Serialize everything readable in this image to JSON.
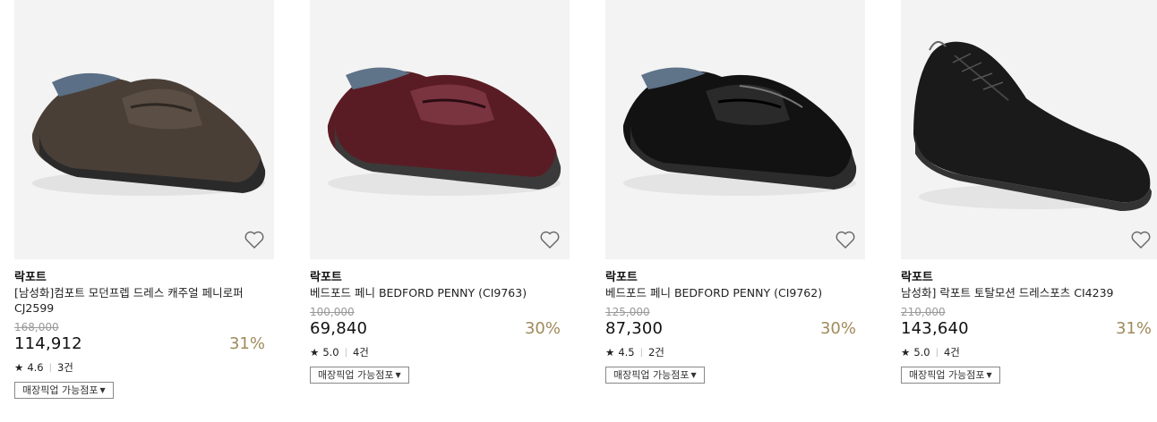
{
  "products": [
    {
      "brand": "락포트",
      "title": "[남성화]컴포트 모던프렙 드레스 캐주얼 페니로퍼 CJ2599",
      "original_price": "168,000",
      "sale_price": "114,912",
      "discount": "31%",
      "rating": "4.6",
      "review_count": "3건",
      "pickup_label": "매장픽업 가능점포",
      "shoe_color": "#4a3f37",
      "wishlist_icon": "heart-outline"
    },
    {
      "brand": "락포트",
      "title": "베드포드 페니 BEDFORD PENNY (CI9763)",
      "original_price": "100,000",
      "sale_price": "69,840",
      "discount": "30%",
      "rating": "5.0",
      "review_count": "4건",
      "pickup_label": "매장픽업 가능점포",
      "shoe_color": "#5a1c24",
      "wishlist_icon": "heart-outline"
    },
    {
      "brand": "락포트",
      "title": "베드포드 페니 BEDFORD PENNY (CI9762)",
      "original_price": "125,000",
      "sale_price": "87,300",
      "discount": "30%",
      "rating": "4.5",
      "review_count": "2건",
      "pickup_label": "매장픽업 가능점포",
      "shoe_color": "#121212",
      "wishlist_icon": "heart-outline"
    },
    {
      "brand": "락포트",
      "title": "남성화] 락포트 토탈모션 드레스포츠 CI4239",
      "original_price": "210,000",
      "sale_price": "143,640",
      "discount": "31%",
      "rating": "5.0",
      "review_count": "4건",
      "pickup_label": "매장픽업 가능점포",
      "shoe_color": "#1a1a1a",
      "wishlist_icon": "heart-outline"
    }
  ],
  "colors": {
    "discount": "#a08a5b",
    "image_bg": "#f3f3f3"
  }
}
